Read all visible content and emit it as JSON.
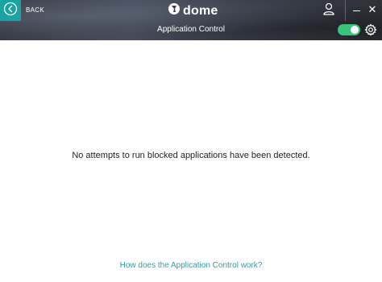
{
  "header": {
    "back_label": "BACK",
    "logo_text": "dome",
    "title": "Application Control",
    "close_glyph": "✕",
    "toggle_state": "on"
  },
  "main": {
    "message": "No attempts to run blocked applications have been detected.",
    "help_link": "How does the Application Control work?"
  },
  "colors": {
    "accent_teal": "#1aa3a3",
    "toggle_green": "#3bc27a",
    "link": "#2aa1b0"
  },
  "icons": {
    "back": "chevron-left-circle-icon",
    "logo": "dome-logo-icon",
    "user": "user-icon",
    "minimize": "minimize-icon",
    "close": "close-icon",
    "settings": "gear-icon"
  }
}
